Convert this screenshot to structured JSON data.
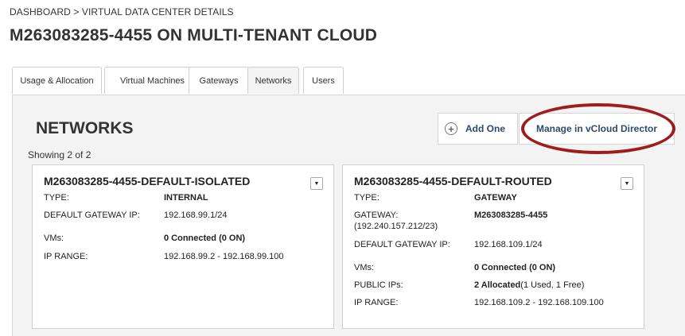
{
  "breadcrumb": "DASHBOARD > VIRTUAL DATA CENTER DETAILS",
  "page_title": "M263083285-4455 ON MULTI-TENANT CLOUD",
  "tabs": [
    {
      "label": "Usage & Allocation"
    },
    {
      "label": "Virtual Machines"
    },
    {
      "label": "Gateways"
    },
    {
      "label": "Networks",
      "active": true
    },
    {
      "label": "Users"
    }
  ],
  "section": {
    "heading": "NETWORKS",
    "showing": "Showing 2 of 2",
    "add_label": "Add One",
    "manage_label": "Manage in vCloud Director"
  },
  "cards": [
    {
      "title": "M263083285-4455-DEFAULT-ISOLATED",
      "type_label": "TYPE:",
      "type_value": "INTERNAL",
      "dgw_label": "DEFAULT GATEWAY IP:",
      "dgw_value": "192.168.99.1/24",
      "vms_label": "VMs:",
      "vms_value": "0 Connected (0 ON)",
      "range_label": "IP RANGE:",
      "range_value": "192.168.99.2 - 192.168.99.100"
    },
    {
      "title": "M263083285-4455-DEFAULT-ROUTED",
      "type_label": "TYPE:",
      "type_value": "GATEWAY",
      "gw_label": "GATEWAY:",
      "gw_sub": "(192.240.157.212/23)",
      "gw_value": "M263083285-4455",
      "dgw_label": "DEFAULT GATEWAY IP:",
      "dgw_value": "192.168.109.1/24",
      "vms_label": "VMs:",
      "vms_value": "0 Connected (0 ON)",
      "pub_label": "PUBLIC IPs:",
      "pub_value": "2 Allocated",
      "pub_detail": "(1 Used, 1 Free)",
      "range_label": "IP RANGE:",
      "range_value": "192.168.109.2 - 192.168.109.100"
    }
  ],
  "colors": {
    "highlight_ellipse": "#9e1c1c",
    "button_text": "#2f4a6a"
  },
  "icons": {
    "add": "plus-circle-icon",
    "dropdown": "caret-down-icon"
  }
}
